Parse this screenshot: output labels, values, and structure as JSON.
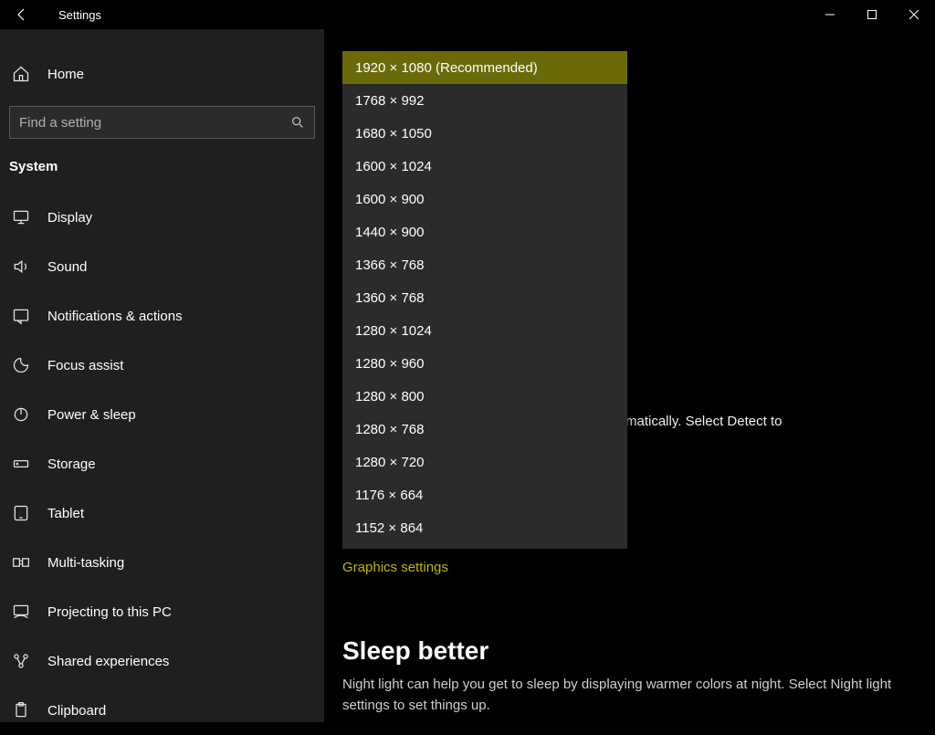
{
  "titlebar": {
    "title": "Settings"
  },
  "sidebar": {
    "home_label": "Home",
    "search_placeholder": "Find a setting",
    "category_label": "System",
    "items": [
      {
        "id": "display",
        "label": "Display",
        "icon": "display-icon"
      },
      {
        "id": "sound",
        "label": "Sound",
        "icon": "sound-icon"
      },
      {
        "id": "notifications",
        "label": "Notifications & actions",
        "icon": "notifications-icon"
      },
      {
        "id": "focus-assist",
        "label": "Focus assist",
        "icon": "focus-assist-icon"
      },
      {
        "id": "power-sleep",
        "label": "Power & sleep",
        "icon": "power-icon"
      },
      {
        "id": "storage",
        "label": "Storage",
        "icon": "storage-icon"
      },
      {
        "id": "tablet",
        "label": "Tablet",
        "icon": "tablet-icon"
      },
      {
        "id": "multitasking",
        "label": "Multi-tasking",
        "icon": "multitasking-icon"
      },
      {
        "id": "projecting",
        "label": "Projecting to this PC",
        "icon": "projecting-icon"
      },
      {
        "id": "shared-exp",
        "label": "Shared experiences",
        "icon": "shared-icon"
      },
      {
        "id": "clipboard",
        "label": "Clipboard",
        "icon": "clipboard-icon"
      }
    ]
  },
  "main": {
    "detect_fragment": "matically. Select Detect to",
    "graphics_link": "Graphics settings",
    "sleep_heading": "Sleep better",
    "sleep_body": "Night light can help you get to sleep by displaying warmer colors at night. Select Night light settings to set things up."
  },
  "resolution_dropdown": {
    "selected_index": 0,
    "options": [
      "1920 × 1080 (Recommended)",
      "1768 × 992",
      "1680 × 1050",
      "1600 × 1024",
      "1600 × 900",
      "1440 × 900",
      "1366 × 768",
      "1360 × 768",
      "1280 × 1024",
      "1280 × 960",
      "1280 × 800",
      "1280 × 768",
      "1280 × 720",
      "1176 × 664",
      "1152 × 864"
    ]
  }
}
